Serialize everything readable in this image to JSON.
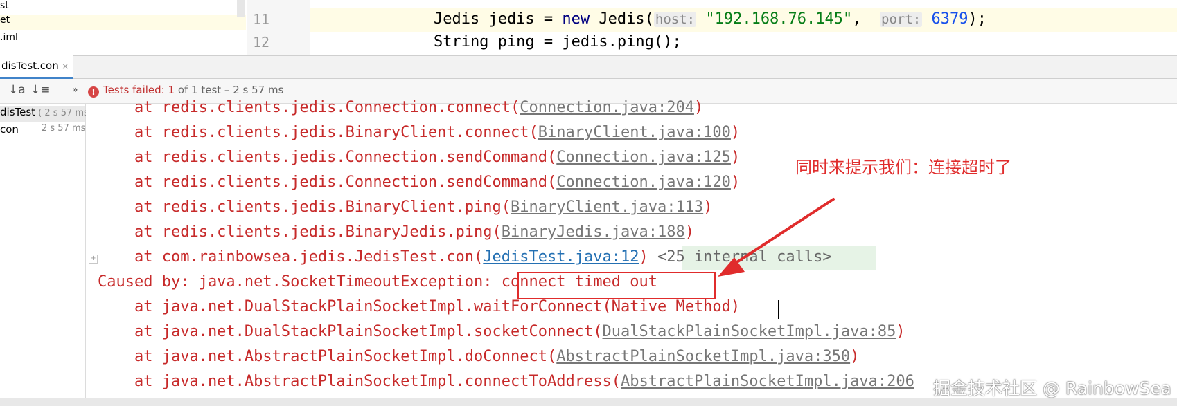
{
  "project_tree": {
    "rows": [
      "st",
      "et",
      ".iml"
    ]
  },
  "editor": {
    "lines": [
      {
        "num": "11",
        "indent": "        ",
        "type_kw": "Jedis",
        "var": " jedis = ",
        "new_kw": "new",
        "ctor": " Jedis(",
        "hint1": "host:",
        "str": "\"192.168.76.145\"",
        "sep": ",  ",
        "hint2": "port:",
        "num_val": "6379",
        "end": ");"
      },
      {
        "num": "12",
        "text": "        String ping = jedis.ping();"
      }
    ]
  },
  "run_tab": {
    "label": "disTest.con",
    "close": "×"
  },
  "toolbar": {
    "sort_alpha_icon": "↓a",
    "sort_dur_icon": "↓≡",
    "more_icon": "»",
    "status_prefix": "Tests failed: 1",
    "status_rest": " of 1 test – 2 s 57 ms"
  },
  "test_tree": {
    "rows": [
      {
        "name": "disTest",
        "time": " ( 2 s 57 ms"
      },
      {
        "name": " con",
        "time": "2 s 57 ms"
      }
    ]
  },
  "console": {
    "lines": [
      {
        "prefix": "    at redis.clients.jedis.Connection.connect(",
        "link": "Connection.java:204",
        "suffix": ")"
      },
      {
        "prefix": "    at redis.clients.jedis.BinaryClient.connect(",
        "link": "BinaryClient.java:100",
        "suffix": ")"
      },
      {
        "prefix": "    at redis.clients.jedis.Connection.sendCommand(",
        "link": "Connection.java:125",
        "suffix": ")"
      },
      {
        "prefix": "    at redis.clients.jedis.Connection.sendCommand(",
        "link": "Connection.java:120",
        "suffix": ")"
      },
      {
        "prefix": "    at redis.clients.jedis.BinaryClient.ping(",
        "link": "BinaryClient.java:113",
        "suffix": ")"
      },
      {
        "prefix": "    at redis.clients.jedis.BinaryJedis.ping(",
        "link": "BinaryJedis.java:188",
        "suffix": ")"
      },
      {
        "prefix": "    at com.rainbowsea.jedis.JedisTest.con(",
        "link": "JedisTest.java:12",
        "suffix": ") ",
        "internal": "<25 internal calls>"
      },
      {
        "prefix": "Caused by: java.net.SocketTimeoutException: ",
        "plain": "connect timed out"
      },
      {
        "prefix": "    at java.net.DualStackPlainSocketImpl.waitForConnect(Native Method)"
      },
      {
        "prefix": "    at java.net.DualStackPlainSocketImpl.socketConnect(",
        "link": "DualStackPlainSocketImpl.java:85",
        "suffix": ")"
      },
      {
        "prefix": "    at java.net.AbstractPlainSocketImpl.doConnect(",
        "link": "AbstractPlainSocketImpl.java:350",
        "suffix": ")"
      },
      {
        "prefix": "    at java.net.AbstractPlainSocketImpl.connectToAddress(",
        "link": "AbstractPlainSocketImpl.java:206",
        "suffix": ")"
      }
    ]
  },
  "annotation": {
    "note": "同时来提示我们：连接超时了"
  },
  "watermark": "掘金技术社区 @ RainbowSea",
  "colors": {
    "error_red": "#c72a2a",
    "annotation_red": "#e02c2c",
    "link_blue": "#2470b3"
  }
}
